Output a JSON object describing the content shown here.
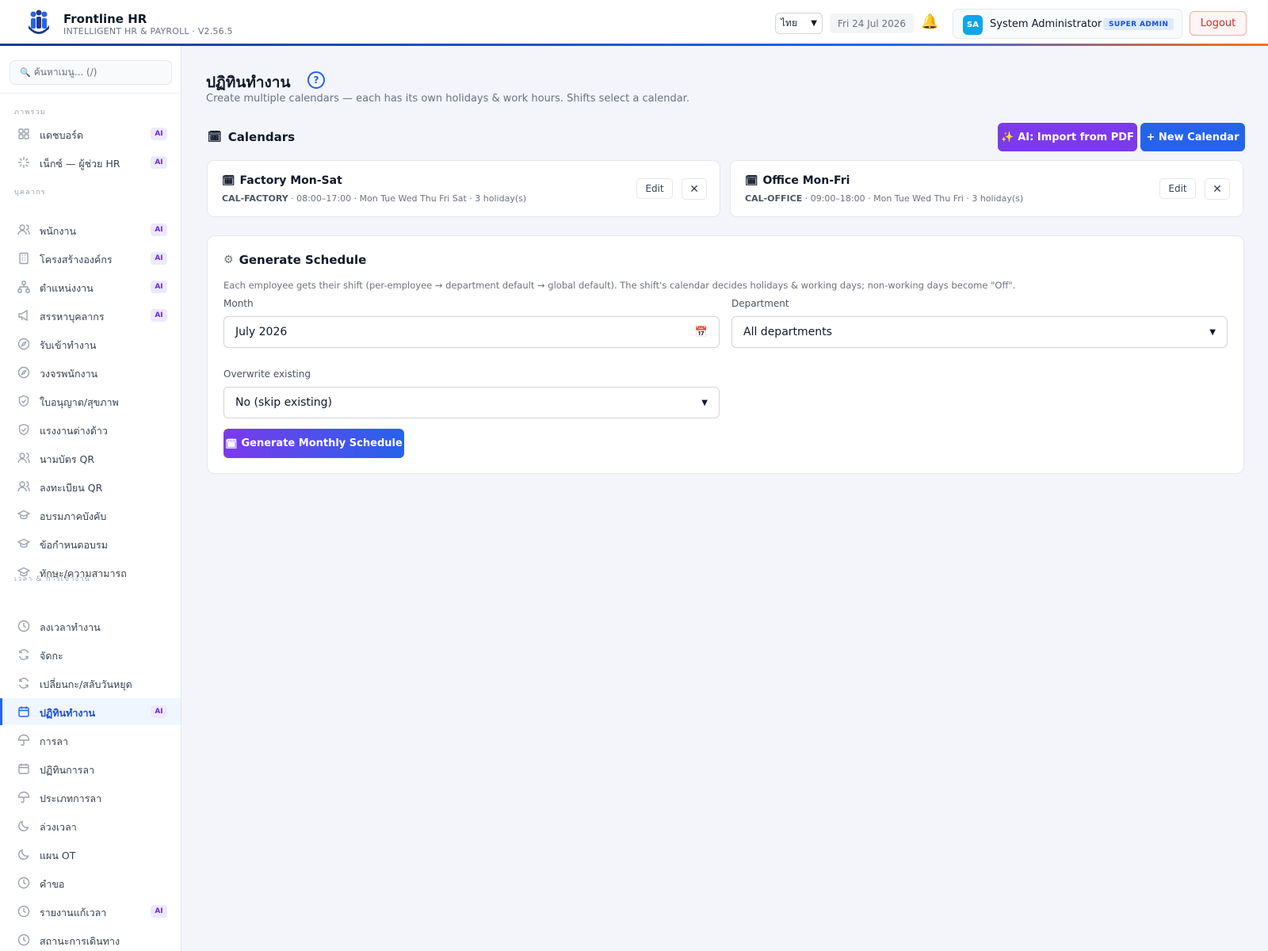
{
  "header": {
    "app_name": "Frontline HR",
    "app_subtitle": "INTELLIGENT HR & PAYROLL · V2.56.5",
    "language": "ไทย",
    "date": "Fri 24 Jul 2026",
    "user_initials": "SA",
    "user_name": "System Administrator",
    "role": "SUPER ADMIN",
    "logout_label": "Logout"
  },
  "sidebar": {
    "search_placeholder": "ค้นหาเมนู... (/)",
    "sections": [
      {
        "title": "ภาพรวม"
      },
      {
        "title": "บุคลากร"
      },
      {
        "title": "เวลา & การเข้างาน"
      }
    ],
    "items": [
      {
        "label": "แดชบอร์ด",
        "icon": "grid-icon",
        "ai": "AI"
      },
      {
        "label": "เน็กซ์ — ผู้ช่วย HR",
        "icon": "sparkle-icon",
        "ai": "AI"
      },
      {
        "label": "พนักงาน",
        "icon": "users-icon",
        "ai": "AI"
      },
      {
        "label": "โครงสร้างองค์กร",
        "icon": "building-icon",
        "ai": "AI"
      },
      {
        "label": "ตำแหน่งงาน",
        "icon": "org-chart-icon",
        "ai": "AI"
      },
      {
        "label": "สรรหาบุคลากร",
        "icon": "megaphone-icon",
        "ai": "AI"
      },
      {
        "label": "รับเข้าทำงาน",
        "icon": "compass-icon"
      },
      {
        "label": "วงจรพนักงาน",
        "icon": "compass-icon"
      },
      {
        "label": "ใบอนุญาต/สุขภาพ",
        "icon": "shield-icon"
      },
      {
        "label": "แรงงานต่างด้าว",
        "icon": "shield-icon"
      },
      {
        "label": "นามบัตร QR",
        "icon": "users-icon"
      },
      {
        "label": "ลงทะเบียน QR",
        "icon": "users-icon"
      },
      {
        "label": "อบรมภาคบังคับ",
        "icon": "graduation-cap-icon"
      },
      {
        "label": "ข้อกำหนดอบรม",
        "icon": "graduation-cap-icon"
      },
      {
        "label": "ทักษะ/ความสามารถ",
        "icon": "graduation-cap-icon"
      },
      {
        "label": "ลงเวลาทำงาน",
        "icon": "clock-icon"
      },
      {
        "label": "จัดกะ",
        "icon": "refresh-icon"
      },
      {
        "label": "เปลี่ยนกะ/สลับวันหยุด",
        "icon": "refresh-icon"
      },
      {
        "label": "ปฏิทินทำงาน",
        "icon": "calendar-icon",
        "ai": "AI"
      },
      {
        "label": "การลา",
        "icon": "umbrella-icon"
      },
      {
        "label": "ปฏิทินการลา",
        "icon": "calendar-icon"
      },
      {
        "label": "ประเภทการลา",
        "icon": "umbrella-icon"
      },
      {
        "label": "ล่วงเวลา",
        "icon": "moon-icon"
      },
      {
        "label": "แผน OT",
        "icon": "moon-icon"
      },
      {
        "label": "คำขอ",
        "icon": "clock-icon"
      },
      {
        "label": "รายงานแก้เวลา",
        "icon": "clock-icon",
        "ai": "AI"
      },
      {
        "label": "สถานะการเดินทาง",
        "icon": "clock-icon"
      }
    ]
  },
  "page": {
    "title": "ปฏิทินทำงาน",
    "help": "?",
    "subtitle": "Create multiple calendars — each has its own holidays & work hours. Shifts select a calendar."
  },
  "calendars": {
    "heading": "Calendars",
    "ai_import_label": "AI: Import from PDF",
    "new_label": "+ New Calendar",
    "edit_label": "Edit",
    "items": [
      {
        "name": "Factory Mon-Sat",
        "code": "CAL-FACTORY",
        "details": " · 08:00–17:00 · Mon Tue Wed Thu Fri Sat · 3 holiday(s)"
      },
      {
        "name": "Office Mon-Fri",
        "code": "CAL-OFFICE",
        "details": " · 09:00–18:00 · Mon Tue Wed Thu Fri · 3 holiday(s)"
      }
    ]
  },
  "generate": {
    "title": "Generate Schedule",
    "description": "Each employee gets their shift (per-employee → department default → global default). The shift's calendar decides holidays & working days; non-working days become \"Off\".",
    "month_label": "Month",
    "month_value": "July 2026",
    "department_label": "Department",
    "department_value": "All departments",
    "overwrite_label": "Overwrite existing",
    "overwrite_value": "No (skip existing)",
    "button_label": "Generate Monthly Schedule"
  }
}
